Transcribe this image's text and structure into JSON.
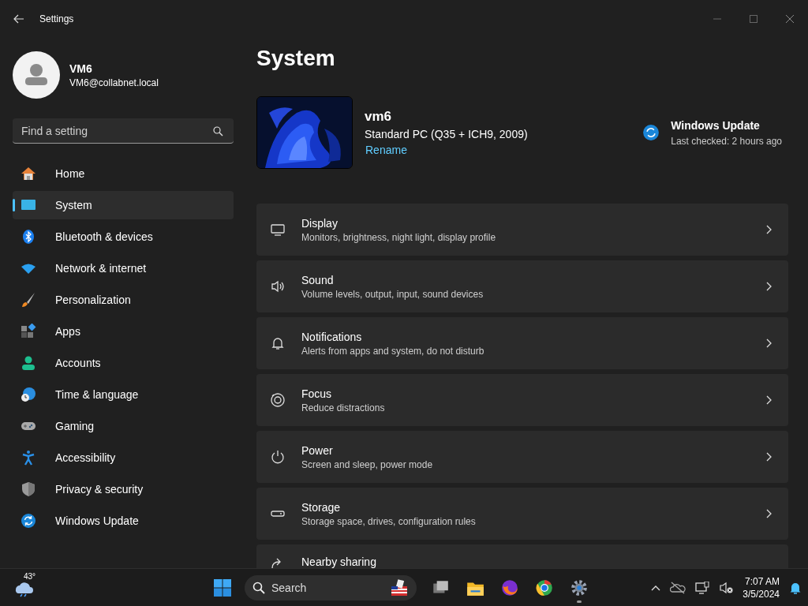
{
  "window": {
    "title": "Settings"
  },
  "user": {
    "name": "VM6",
    "email": "VM6@collabnet.local"
  },
  "search": {
    "placeholder": "Find a setting"
  },
  "nav": [
    {
      "label": "Home",
      "selected": false
    },
    {
      "label": "System",
      "selected": true
    },
    {
      "label": "Bluetooth & devices",
      "selected": false
    },
    {
      "label": "Network & internet",
      "selected": false
    },
    {
      "label": "Personalization",
      "selected": false
    },
    {
      "label": "Apps",
      "selected": false
    },
    {
      "label": "Accounts",
      "selected": false
    },
    {
      "label": "Time & language",
      "selected": false
    },
    {
      "label": "Gaming",
      "selected": false
    },
    {
      "label": "Accessibility",
      "selected": false
    },
    {
      "label": "Privacy & security",
      "selected": false
    },
    {
      "label": "Windows Update",
      "selected": false
    }
  ],
  "page": {
    "title": "System"
  },
  "device": {
    "name": "vm6",
    "model": "Standard PC (Q35 + ICH9, 2009)",
    "rename": "Rename"
  },
  "update": {
    "title": "Windows Update",
    "status": "Last checked: 2 hours ago"
  },
  "cards": [
    {
      "title": "Display",
      "subtitle": "Monitors, brightness, night light, display profile"
    },
    {
      "title": "Sound",
      "subtitle": "Volume levels, output, input, sound devices"
    },
    {
      "title": "Notifications",
      "subtitle": "Alerts from apps and system, do not disturb"
    },
    {
      "title": "Focus",
      "subtitle": "Reduce distractions"
    },
    {
      "title": "Power",
      "subtitle": "Screen and sleep, power mode"
    },
    {
      "title": "Storage",
      "subtitle": "Storage space, drives, configuration rules"
    },
    {
      "title": "Nearby sharing"
    }
  ],
  "taskbar": {
    "weather": "43°",
    "search": "Search",
    "time": "7:07 AM",
    "date": "3/5/2024",
    "apps": [
      {
        "running": false
      },
      {
        "running": false
      },
      {
        "running": false
      },
      {
        "running": false
      },
      {
        "running": true
      }
    ]
  }
}
